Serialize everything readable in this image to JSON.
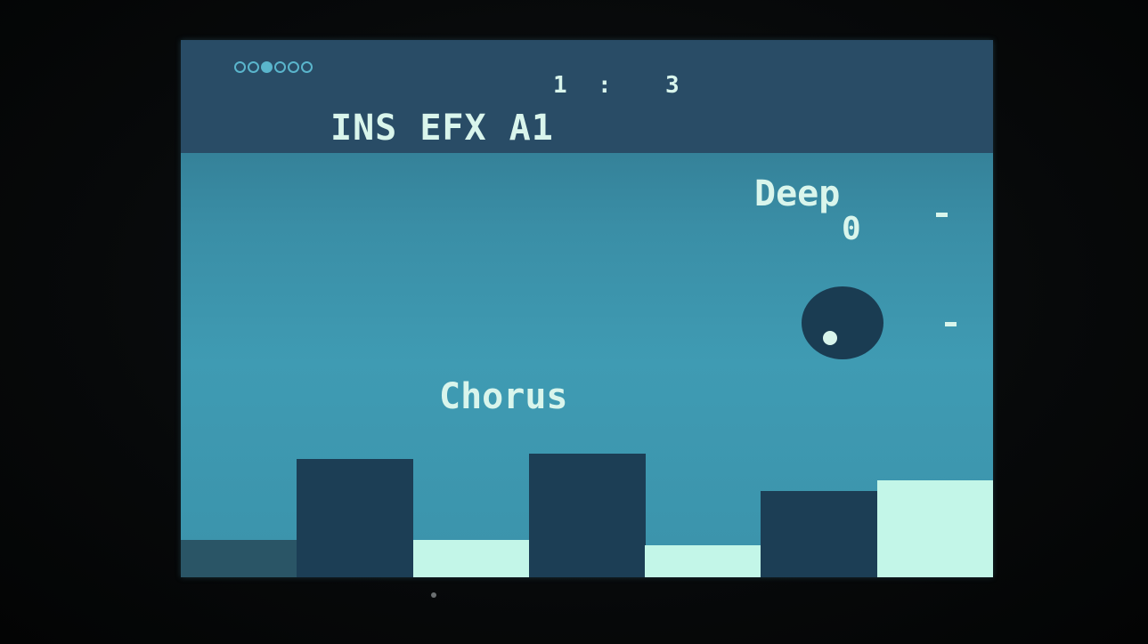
{
  "header": {
    "page_indicator": {
      "count": 6,
      "active_index": 2
    },
    "position_a": "1",
    "position_sep": ":",
    "position_b": "3",
    "title": "INS EFX A1"
  },
  "parameter": {
    "name": "Deep",
    "value": "0",
    "knob_level": 0
  },
  "effect": {
    "name": "Chorus"
  },
  "bars": {
    "levels": [
      0.07,
      0.22,
      0.07,
      0.23,
      0.06,
      0.16,
      0.18
    ],
    "colors": [
      "#2a5566",
      "#1c3e55",
      "#c3f6e8",
      "#1c3e55",
      "#c3f6e8",
      "#1c3e55",
      "#c3f6e8"
    ]
  },
  "colors": {
    "screen_background": "#3a8ea6",
    "header_background": "#294c66",
    "text": "#d9f5ec",
    "knob": "#1a3c52",
    "page_dot": "#5ab5cc"
  }
}
